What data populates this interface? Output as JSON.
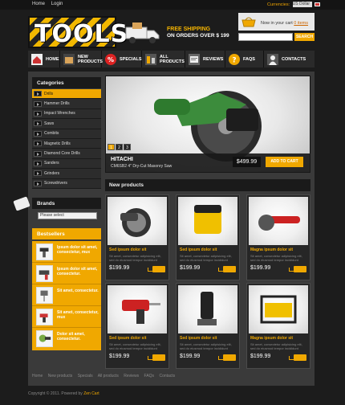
{
  "toplinks": {
    "home": "Home",
    "login": "Login"
  },
  "currency": {
    "label": "Currencies:",
    "value": "US Dollar"
  },
  "logo": {
    "text": "TOOLS"
  },
  "shipping": {
    "line1": "FREE SHIPPING",
    "line2": "ON ORDERS OVER $ 199"
  },
  "cart": {
    "text": "Now in your cart",
    "link": "0 items"
  },
  "search": {
    "placeholder": "",
    "button": "SEARCH"
  },
  "nav": [
    {
      "label": "HOME",
      "icon": "home-icon"
    },
    {
      "label": "NEW PRODUCTS",
      "icon": "box-icon"
    },
    {
      "label": "SPECIALS",
      "icon": "percent-icon"
    },
    {
      "label": "ALL PRODUCTS",
      "icon": "products-icon"
    },
    {
      "label": "REVIEWS",
      "icon": "reviews-icon"
    },
    {
      "label": "FAQS",
      "icon": "question-icon"
    },
    {
      "label": "CONTACTS",
      "icon": "person-icon"
    }
  ],
  "categories": {
    "title": "Categories",
    "items": [
      "Drills",
      "Hammer Drills",
      "Impact Wrenches",
      "Saws",
      "Combits",
      "Magnetic Drills",
      "Diamond Core Drills",
      "Sanders",
      "Grinders",
      "Screwdrivers"
    ]
  },
  "brands": {
    "title": "Brands",
    "select": "Please select"
  },
  "bestsellers": {
    "title": "Bestsellers",
    "items": [
      "Ipsum dolor sit amet, consectetur, mux",
      "Ipsum dolor sit amet, consectetur.",
      "Sit amet, consectetur.",
      "Sit amet, consectetur, mux",
      "Dolor sit amet, consectetur."
    ]
  },
  "slider": {
    "title": "HITACHI",
    "subtitle": "CM6SB2 4\" Dry-Cut Masonry Saw",
    "price": "$499.99",
    "button": "ADD TO CART",
    "pages": [
      "1",
      "2",
      "3"
    ]
  },
  "new_products": {
    "title": "New products",
    "items": [
      {
        "name": "Sed ipsum dolor sit",
        "desc": "Sit amet, consectetur adipisicing elit, sed do eiusmod tempor incididunt",
        "price": "$199.99"
      },
      {
        "name": "Sed ipsum dolor sit",
        "desc": "Sit amet, consectetur adipisicing elit, sed do eiusmod tempor incididunt",
        "price": "$199.99"
      },
      {
        "name": "Magna ipsum dolor sit",
        "desc": "Sit amet, consectetur adipisicing elit, sed do eiusmod tempor incididunt",
        "price": "$199.99"
      },
      {
        "name": "Sed ipsum dolor sit",
        "desc": "Sit amet, consectetur adipisicing elit, sed do eiusmod tempor incididunt",
        "price": "$199.99"
      },
      {
        "name": "Sed ipsum dolor sit",
        "desc": "Sit amet, consectetur adipisicing elit, sed do eiusmod tempor incididunt",
        "price": "$199.99"
      },
      {
        "name": "Magna ipsum dolor sit",
        "desc": "Sit amet, consectetur adipisicing elit, sed do eiusmod tempor incididunt",
        "price": "$199.99"
      }
    ]
  },
  "footer": {
    "links": [
      "Home",
      "New products",
      "Specials",
      "All products",
      "Reviews",
      "FAQs",
      "Contacts"
    ],
    "copyright_prefix": "Copyright © 2011. Powered by",
    "copyright_link": "Zen Cart"
  },
  "colors": {
    "accent": "#f0a800",
    "background": "#1c1c1c",
    "panel": "#3a3a3a"
  }
}
